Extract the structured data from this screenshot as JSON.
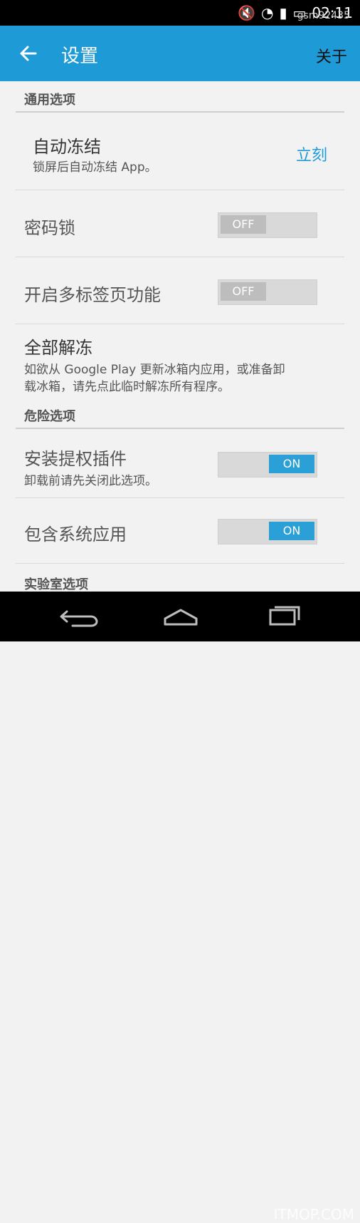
{
  "status": {
    "time": "02:11",
    "carrier": "gsm92435"
  },
  "actionbar": {
    "title": "设置",
    "about": "关于"
  },
  "sections": {
    "general": {
      "header": "通用选项",
      "auto_freeze": {
        "title": "自动冻结",
        "subtitle": "锁屏后自动冻结 App。",
        "value": "立刻"
      },
      "password_lock": {
        "title": "密码锁",
        "toggle": "OFF"
      },
      "multi_tab": {
        "title": "开启多标签页功能",
        "toggle": "OFF"
      },
      "unfreeze_all": {
        "title": "全部解冻",
        "desc_line1": "如欲从 Google Play 更新冰箱内应用，或准备卸",
        "desc_line2": "载冰箱，请先点此临时解冻所有程序。"
      }
    },
    "danger": {
      "header": "危险选项",
      "install_plugin": {
        "title": "安装提权插件",
        "subtitle": "卸载前请先关闭此选项。",
        "toggle": "ON"
      },
      "include_system": {
        "title": "包含系统应用",
        "toggle": "ON"
      }
    },
    "lab": {
      "header": "实验室选项"
    }
  },
  "watermark": "ITMOP.COM",
  "colors": {
    "actionbar": "#1e9bd7",
    "accent": "#1e9bd7"
  }
}
